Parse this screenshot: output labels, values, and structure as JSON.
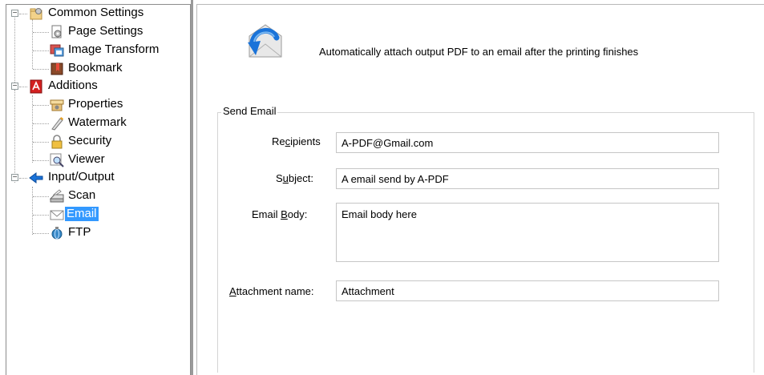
{
  "tree": {
    "nodes": [
      {
        "label": "Common Settings",
        "icon": "settings-folder-icon"
      },
      {
        "label": "Page Settings",
        "icon": "page-settings-icon"
      },
      {
        "label": "Image Transform",
        "icon": "image-transform-icon"
      },
      {
        "label": "Bookmark",
        "icon": "bookmark-icon"
      },
      {
        "label": "Additions",
        "icon": "pdf-additions-icon"
      },
      {
        "label": "Properties",
        "icon": "properties-icon"
      },
      {
        "label": "Watermark",
        "icon": "watermark-icon"
      },
      {
        "label": "Security",
        "icon": "security-lock-icon"
      },
      {
        "label": "Viewer",
        "icon": "viewer-magnifier-icon"
      },
      {
        "label": "Input/Output",
        "icon": "input-output-arrow-icon"
      },
      {
        "label": "Scan",
        "icon": "scanner-icon"
      },
      {
        "label": "Email",
        "icon": "envelope-icon",
        "selected": true
      },
      {
        "label": "FTP",
        "icon": "ftp-globe-icon"
      }
    ],
    "toggle_glyph": "−"
  },
  "panel": {
    "header_text": "Automatically attach output PDF to an email after the printing finishes",
    "group_title": "Send Email",
    "fields": {
      "recipients": {
        "label_pre": "Re",
        "label_u": "c",
        "label_post": "ipients",
        "value": "A-PDF@Gmail.com"
      },
      "subject": {
        "label_pre": "S",
        "label_u": "u",
        "label_post": "bject:",
        "value": "A email send by A-PDF"
      },
      "body": {
        "label_pre": "Email ",
        "label_u": "B",
        "label_post": "ody:",
        "value": "Email body here"
      },
      "attachment": {
        "label_pre": "",
        "label_u": "A",
        "label_post": "ttachment name:",
        "value": "Attachment"
      }
    }
  },
  "colors": {
    "selection": "#3399ff",
    "pdf_red": "#d42020",
    "arrow_blue": "#1a73d9"
  }
}
